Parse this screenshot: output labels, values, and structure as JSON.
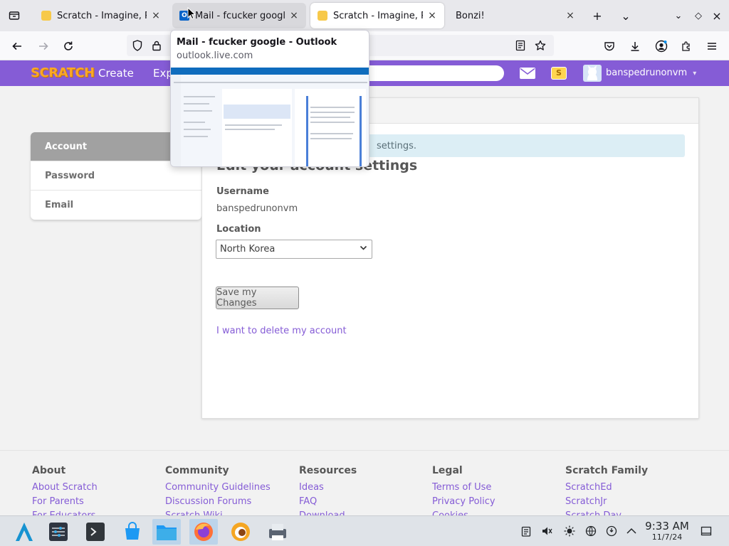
{
  "browser": {
    "tabs": [
      {
        "title": "Scratch - Imagine, Program, Share",
        "close": "×",
        "state": "normal"
      },
      {
        "title": "Mail - fcucker google - Outlook",
        "close": "×",
        "state": "hovered"
      },
      {
        "title": "Scratch - Imagine, Program, Share",
        "close": "×",
        "state": "active"
      },
      {
        "title": "Bonzi!",
        "close": "×",
        "state": "normal"
      }
    ],
    "new_tab": "+",
    "list_tabs": "⌄",
    "window_controls": {
      "minimize": "⌄",
      "maximize": "◇",
      "close": "×"
    }
  },
  "tab_preview": {
    "title": "Mail - fcucker google - Outlook",
    "url": "outlook.live.com"
  },
  "scratch_header": {
    "logo": "SCRATCH",
    "nav": [
      "Create",
      "Exp"
    ],
    "stuff_badge": "S",
    "username": "banspedrunonvm",
    "dropdown_caret": "▾"
  },
  "settings_sidebar": {
    "items": [
      "Account",
      "Password",
      "Email"
    ],
    "selected": "Account"
  },
  "account_form": {
    "info_message": "settings.",
    "title": "Edit your account settings",
    "username_label": "Username",
    "username_value": "banspedrunonvm",
    "location_label": "Location",
    "location_value": "North Korea",
    "save_button": "Save my Changes",
    "delete_link": "I want to delete my account"
  },
  "footer": {
    "columns": [
      {
        "heading": "About",
        "links": [
          "About Scratch",
          "For Parents",
          "For Educators"
        ]
      },
      {
        "heading": "Community",
        "links": [
          "Community Guidelines",
          "Discussion Forums",
          "Scratch Wiki"
        ]
      },
      {
        "heading": "Resources",
        "links": [
          "Ideas",
          "FAQ",
          "Download"
        ]
      },
      {
        "heading": "Legal",
        "links": [
          "Terms of Use",
          "Privacy Policy",
          "Cookies"
        ]
      },
      {
        "heading": "Scratch Family",
        "links": [
          "ScratchEd",
          "ScratchJr",
          "Scratch Day"
        ]
      }
    ]
  },
  "taskbar": {
    "clock_time": "9:33 AM",
    "clock_date": "11/7/24"
  },
  "colors": {
    "scratch_purple": "#855cd6",
    "info_bar": "#dceef5",
    "sidebar_selected": "#a1a1a1"
  }
}
